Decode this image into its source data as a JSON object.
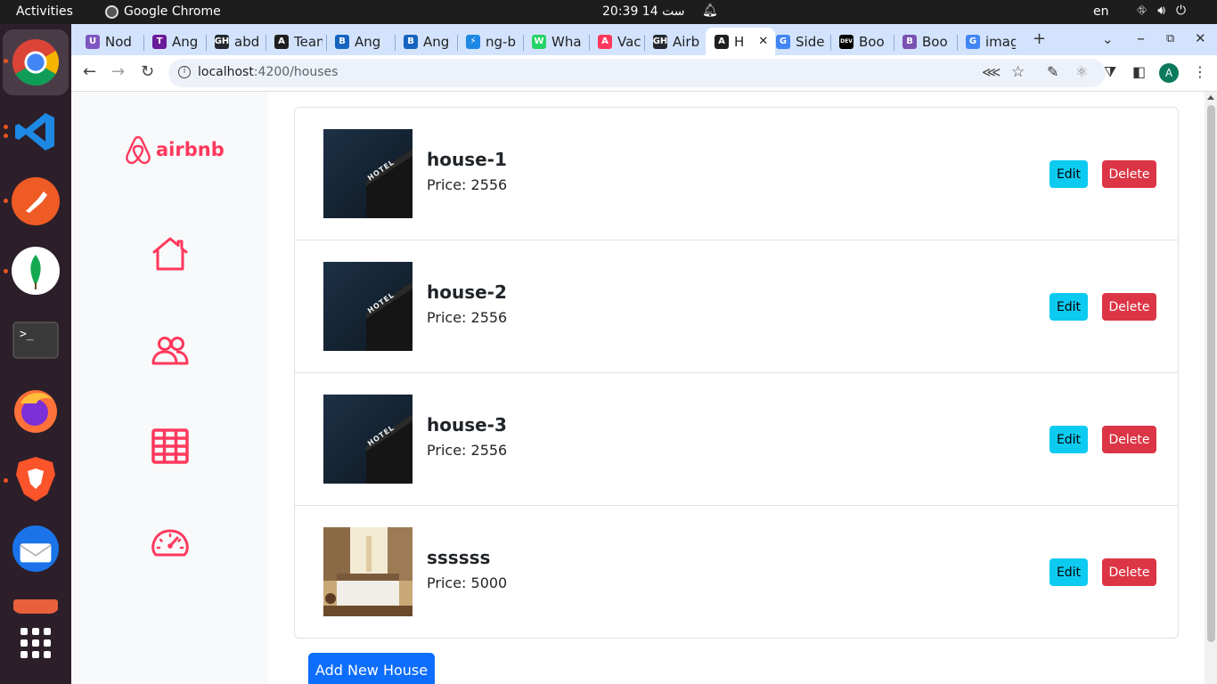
{
  "topbar": {
    "activities": "Activities",
    "app_name": "Google Chrome",
    "clock": "20:39  14 ست",
    "lang": "en"
  },
  "tabs": [
    {
      "label": "Nod",
      "favicon_color": "#7e57c2",
      "favicon": "U"
    },
    {
      "label": "Ang",
      "favicon_color": "#6a1b9a",
      "favicon": "T"
    },
    {
      "label": "abd",
      "favicon_color": "#24292f",
      "favicon": "GH"
    },
    {
      "label": "Tean",
      "favicon_color": "#1f1f1f",
      "favicon": "A"
    },
    {
      "label": "Ang",
      "favicon_color": "#1565c0",
      "favicon": "B"
    },
    {
      "label": "Ang",
      "favicon_color": "#1565c0",
      "favicon": "B"
    },
    {
      "label": "ng-b",
      "favicon_color": "#1e88e5",
      "favicon": "⚡"
    },
    {
      "label": "Wha",
      "favicon_color": "#25d366",
      "favicon": "W"
    },
    {
      "label": "Vaca",
      "favicon_color": "#ff385c",
      "favicon": "A"
    },
    {
      "label": "Airb",
      "favicon_color": "#24292f",
      "favicon": "GH"
    },
    {
      "label": "H",
      "favicon_color": "#1f1f1f",
      "favicon": "A",
      "active": true
    },
    {
      "label": "Side",
      "favicon_color": "#4285f4",
      "favicon": "G"
    },
    {
      "label": "Boo",
      "favicon_color": "#000000",
      "favicon": "DEV"
    },
    {
      "label": "Boo",
      "favicon_color": "#7952b3",
      "favicon": "B"
    },
    {
      "label": "imag",
      "favicon_color": "#4285f4",
      "favicon": "G"
    }
  ],
  "omnibox": {
    "host": "localhost",
    "path": ":4200/houses"
  },
  "profile_initial": "A",
  "brand": {
    "name": "airbnb",
    "color": "#ff385c"
  },
  "sidebar_icons": [
    "home-icon",
    "users-icon",
    "grid-icon",
    "speedometer-icon"
  ],
  "houses": [
    {
      "name": "house-1",
      "price_label": "Price:",
      "price": "2556",
      "image": "hotel-night"
    },
    {
      "name": "house-2",
      "price_label": "Price:",
      "price": "2556",
      "image": "hotel-night"
    },
    {
      "name": "house-3",
      "price_label": "Price:",
      "price": "2556",
      "image": "hotel-night"
    },
    {
      "name": "ssssss",
      "price_label": "Price:",
      "price": "5000",
      "image": "bedroom"
    }
  ],
  "buttons": {
    "edit": "Edit",
    "delete": "Delete",
    "add": "Add New House"
  },
  "colors": {
    "edit": "#0dcaf0",
    "delete": "#dc3545",
    "primary": "#0d6efd"
  }
}
